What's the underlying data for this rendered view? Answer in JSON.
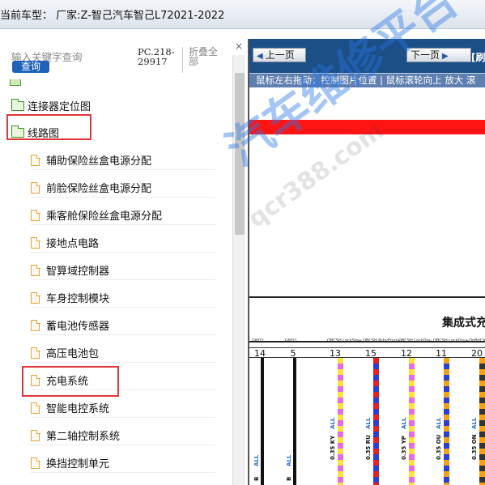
{
  "header": {
    "title": "当前车型： 厂家:Z-智己汽车智己L72021-2022"
  },
  "search": {
    "placeholder": "输入关键字查询",
    "button": "查询"
  },
  "doc_code": "PC.218-29917",
  "collapse_all": "折叠全部",
  "close_symbol": "×",
  "tree": {
    "folders": [
      {
        "label": "连接器定位图"
      },
      {
        "label": "线路图"
      }
    ],
    "docs": [
      {
        "label": "辅助保险丝盒电源分配"
      },
      {
        "label": "前脸保险丝盒电源分配"
      },
      {
        "label": "乘客舱保险丝盒电源分配"
      },
      {
        "label": "接地点电路"
      },
      {
        "label": "智算域控制器"
      },
      {
        "label": "车身控制模块"
      },
      {
        "label": "蓄电池传感器"
      },
      {
        "label": "高压电池包"
      },
      {
        "label": "充电系统"
      },
      {
        "label": "智能电控系统"
      },
      {
        "label": "第二轴控制系统"
      },
      {
        "label": "换挡控制单元"
      }
    ]
  },
  "viewer": {
    "prev_label": "上一页",
    "next_label": "下一页",
    "truncated_label": "[刷",
    "hint": "鼠标左右拖动：控制图片位置 | 鼠标滚轮向上 放大   滚",
    "diagram_title": "集成式充",
    "pins": [
      {
        "label": "GND2",
        "num": "14"
      },
      {
        "label": "GND1",
        "num": "5"
      },
      {
        "label": "OBCSH.LockSta+",
        "num": "13"
      },
      {
        "label": "OBCSH.PshvErrst+",
        "num": "15"
      },
      {
        "label": "OBCSH.LockDrv-",
        "num": "12"
      },
      {
        "label": "OBCSH.LockDrv+",
        "num": "11"
      },
      {
        "label": "OnBdChrg",
        "num": "20"
      }
    ],
    "wires": [
      {
        "size": "0.35",
        "code": "KY",
        "all": "ALL",
        "c1": "#ffe438",
        "c2": "#e66be6"
      },
      {
        "size": "0.35",
        "code": "RU",
        "all": "ALL",
        "c1": "#e82020",
        "c2": "#2a3fd6"
      },
      {
        "size": "0.35",
        "code": "YP",
        "all": "ALL",
        "c1": "#ffe438",
        "c2": "#e66be6"
      },
      {
        "size": "0.35",
        "code": "OU",
        "all": "ALL",
        "c1": "#f5a015",
        "c2": "#2a3fd6"
      },
      {
        "size": "0.35",
        "code": "ON",
        "all": "ALL",
        "c1": "#f5a015",
        "c2": "#333333"
      }
    ],
    "ground_labels": [
      "B",
      "ALL",
      "B",
      "ALL"
    ]
  },
  "watermark": {
    "main": "汽车维修平台",
    "site": "qcr388.com"
  },
  "colors": {
    "toolbar": "#1b4f86",
    "hint_bar": "#5f7fb0",
    "highlight": "#e2353a",
    "red_band": "#ff1414"
  }
}
